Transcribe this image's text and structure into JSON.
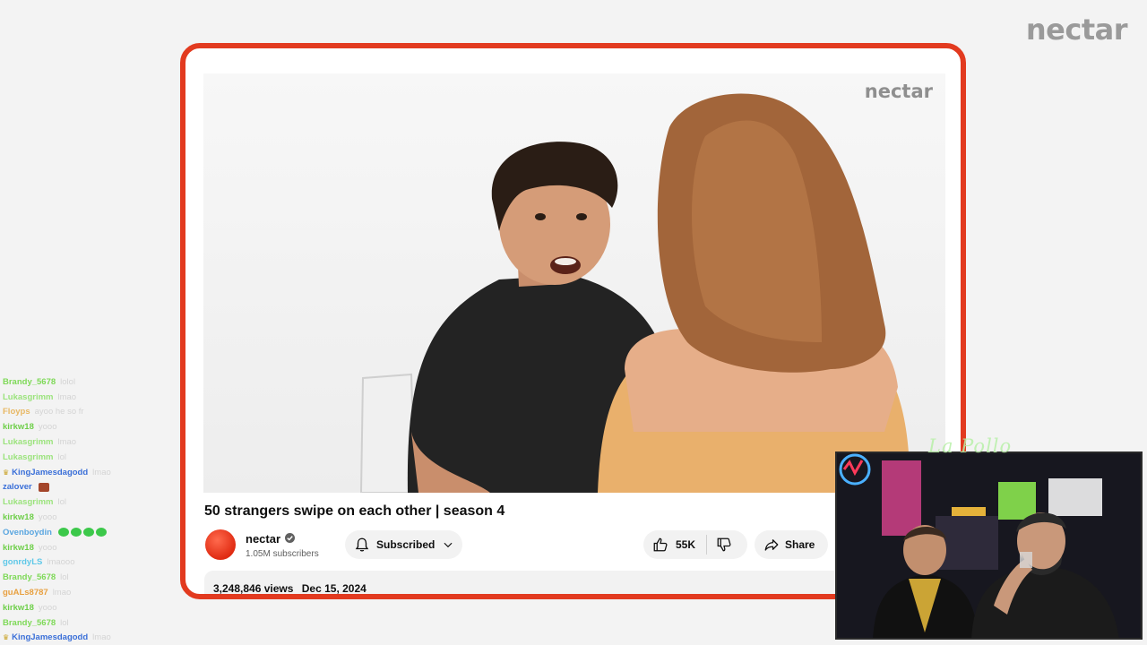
{
  "brand": {
    "logo_text": "nectar"
  },
  "video": {
    "watermark": "nectar",
    "title": "50 strangers swipe on each other | season 4"
  },
  "channel": {
    "name": "nectar",
    "subscribers": "1.05M subscribers",
    "subscribe_label": "Subscribed"
  },
  "actions": {
    "like_count": "55K",
    "share_label": "Share"
  },
  "description": {
    "views": "3,248,846 views",
    "date": "Dec 15, 2024"
  },
  "chat": [
    {
      "user": "Brandy_5678",
      "color": "#7ed957",
      "msg": "lolol"
    },
    {
      "user": "Lukasgrimm",
      "color": "#9be37c",
      "msg": "lmao"
    },
    {
      "user": "Floyps",
      "color": "#e8b864",
      "msg": "ayoo he so fr"
    },
    {
      "user": "kirkw18",
      "color": "#6fcf4a",
      "msg": "yooo"
    },
    {
      "user": "Lukasgrimm",
      "color": "#9be37c",
      "msg": "lmao"
    },
    {
      "user": "Lukasgrimm",
      "color": "#9be37c",
      "msg": "lol"
    },
    {
      "user": "KingJamesdagodd",
      "color": "#3a6fd8",
      "msg": "lmao",
      "badge": true
    },
    {
      "user": "zalover",
      "color": "#3a6fd8",
      "msg": "",
      "emote": "#a3452a"
    },
    {
      "user": "Lukasgrimm",
      "color": "#9be37c",
      "msg": "lol"
    },
    {
      "user": "kirkw18",
      "color": "#6fcf4a",
      "msg": "yooo"
    },
    {
      "user": "Ovenboydin",
      "color": "#5aa6e0",
      "msg": "",
      "emotes": 4
    },
    {
      "user": "kirkw18",
      "color": "#6fcf4a",
      "msg": "yooo"
    },
    {
      "user": "gonrdyLS",
      "color": "#5ec8e8",
      "msg": "lmaooo"
    },
    {
      "user": "Brandy_5678",
      "color": "#7ed957",
      "msg": "lol"
    },
    {
      "user": "guALs8787",
      "color": "#e8a040",
      "msg": "lmao"
    },
    {
      "user": "kirkw18",
      "color": "#6fcf4a",
      "msg": "yooo"
    },
    {
      "user": "Brandy_5678",
      "color": "#7ed957",
      "msg": "lol"
    },
    {
      "user": "KingJamesdagodd",
      "color": "#3a6fd8",
      "msg": "lmao",
      "badge": true
    }
  ],
  "webcam": {
    "signature": "La Pollo"
  },
  "colors": {
    "frame_border": "#e23a1f",
    "avatar": "#e02b12",
    "background": "#f3f3f3"
  }
}
